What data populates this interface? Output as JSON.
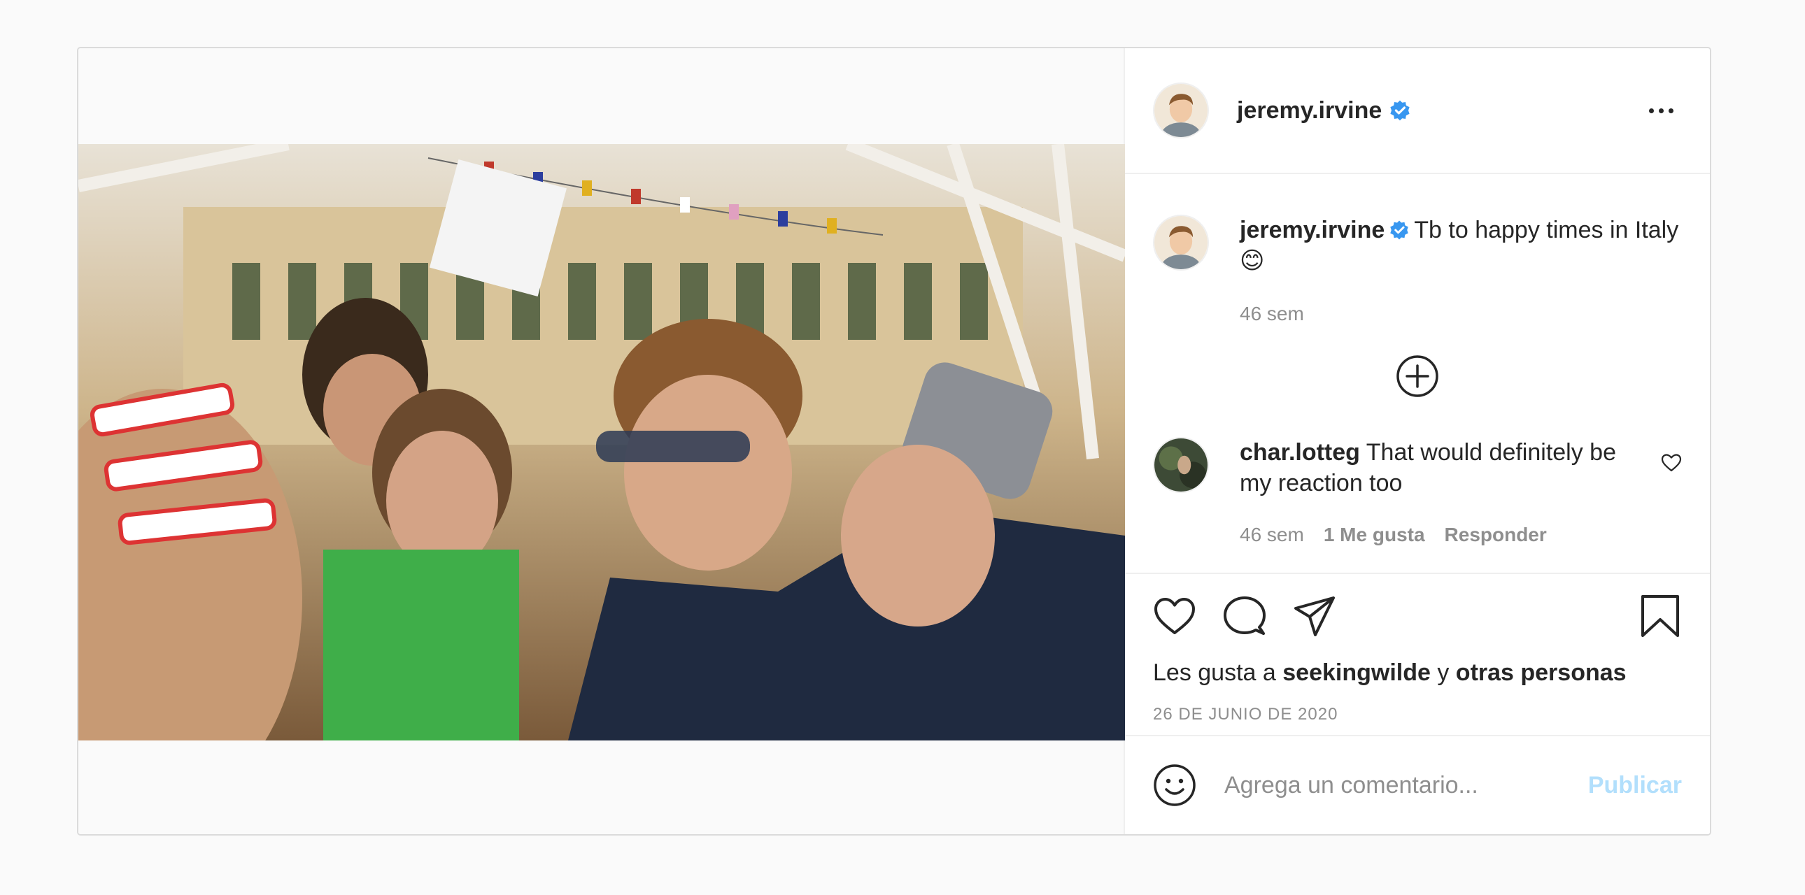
{
  "post": {
    "username": "jeremy.irvine",
    "caption_text": "Tb to happy times in Italy",
    "caption_emoji": "😊",
    "caption_time": "46 sem"
  },
  "comments": [
    {
      "username": "char.lotteg",
      "text": "That would definitely be my reaction too",
      "time": "46 sem",
      "likes": "1 Me gusta",
      "reply": "Responder"
    }
  ],
  "likes": {
    "prefix": "Les gusta a",
    "user": "seekingwilde",
    "joiner": "y",
    "others": "otras personas"
  },
  "date": "26 DE JUNIO DE 2020",
  "composer": {
    "placeholder": "Agrega un comentario...",
    "post_label": "Publicar"
  },
  "icons": {
    "more": "more-options-icon",
    "verified": "verified-badge-icon",
    "load_more": "plus-circle-icon",
    "like": "heart-icon",
    "comment": "comment-bubble-icon",
    "share": "paper-plane-icon",
    "save": "bookmark-icon",
    "emoji": "smiley-icon"
  },
  "colors": {
    "verified": "#3897f0",
    "text": "#262626",
    "secondary": "#8e8e8e",
    "post_button_disabled": "#b2dffc"
  }
}
